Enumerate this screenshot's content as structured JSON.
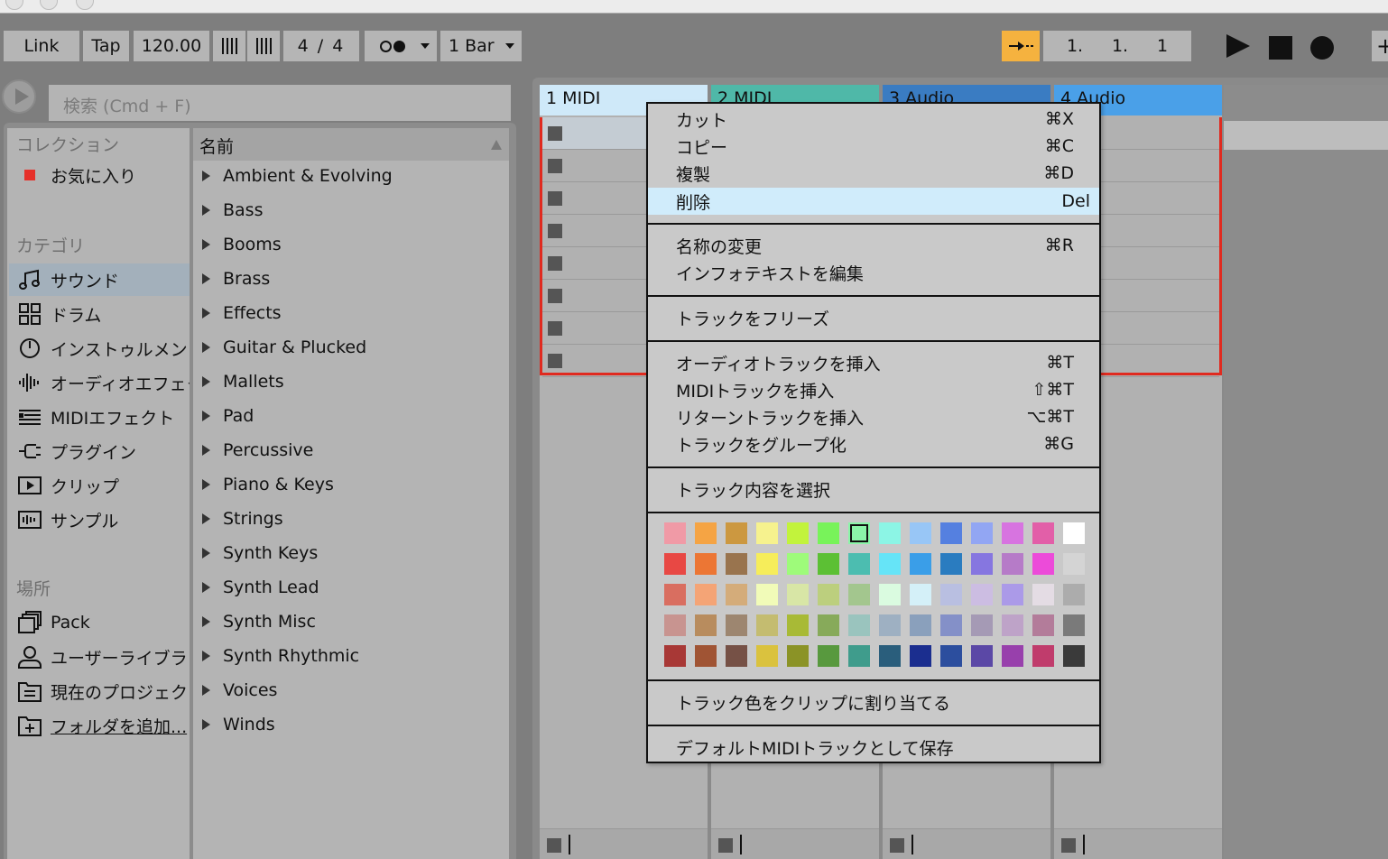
{
  "transport": {
    "link": "Link",
    "tap": "Tap",
    "tempo": "120.00",
    "signature": "4 / 4",
    "quantize": "1 Bar",
    "arrangement_pos": [
      "1.",
      "1.",
      "1"
    ]
  },
  "browser": {
    "search_placeholder": "検索 (Cmd + F)",
    "collections_header": "コレクション",
    "favorites": "お気に入り",
    "categories_header": "カテゴリ",
    "categories": [
      {
        "label": "サウンド",
        "icon": "music-note-icon"
      },
      {
        "label": "ドラム",
        "icon": "drum-grid-icon"
      },
      {
        "label": "インストゥルメント",
        "icon": "clock-icon"
      },
      {
        "label": "オーディオエフェクト",
        "icon": "waveform-icon"
      },
      {
        "label": "MIDIエフェクト",
        "icon": "midi-lines-icon"
      },
      {
        "label": "プラグイン",
        "icon": "plug-icon"
      },
      {
        "label": "クリップ",
        "icon": "clip-icon"
      },
      {
        "label": "サンプル",
        "icon": "sample-icon"
      }
    ],
    "places_header": "場所",
    "places": [
      {
        "label": "Pack",
        "icon": "pack-icon"
      },
      {
        "label": "ユーザーライブラリ",
        "icon": "user-icon"
      },
      {
        "label": "現在のプロジェクト",
        "icon": "project-folder-icon"
      },
      {
        "label": "フォルダを追加...",
        "icon": "add-folder-icon"
      }
    ],
    "list_header": "名前",
    "items": [
      "Ambient & Evolving",
      "Bass",
      "Booms",
      "Brass",
      "Effects",
      "Guitar & Plucked",
      "Mallets",
      "Pad",
      "Percussive",
      "Piano & Keys",
      "Strings",
      "Synth Keys",
      "Synth Lead",
      "Synth Misc",
      "Synth Rhythmic",
      "Voices",
      "Winds"
    ]
  },
  "tracks": [
    {
      "name": "1 MIDI",
      "color": "#cfe9f9"
    },
    {
      "name": "2 MIDI",
      "color": "#4fb8a8"
    },
    {
      "name": "3 Audio",
      "color": "#3a7cc2"
    },
    {
      "name": "4 Audio",
      "color": "#4aa0e8"
    }
  ],
  "menu": {
    "items": [
      {
        "label": "カット",
        "shortcut": "⌘X"
      },
      {
        "label": "コピー",
        "shortcut": "⌘C"
      },
      {
        "label": "複製",
        "shortcut": "⌘D"
      },
      {
        "label": "削除",
        "shortcut": "Del"
      },
      {
        "label": "名称の変更",
        "shortcut": "⌘R"
      },
      {
        "label": "インフォテキストを編集",
        "shortcut": ""
      },
      {
        "label": "トラックをフリーズ",
        "shortcut": ""
      },
      {
        "label": "オーディオトラックを挿入",
        "shortcut": "⌘T"
      },
      {
        "label": "MIDIトラックを挿入",
        "shortcut": "⇧⌘T"
      },
      {
        "label": "リターントラックを挿入",
        "shortcut": "⌥⌘T"
      },
      {
        "label": "トラックをグループ化",
        "shortcut": "⌘G"
      },
      {
        "label": "トラック内容を選択",
        "shortcut": ""
      },
      {
        "label": "トラック色をクリップに割り当てる",
        "shortcut": ""
      },
      {
        "label": "デフォルトMIDIトラックとして保存",
        "shortcut": ""
      }
    ],
    "highlighted_index": 3,
    "selected_color_index": 6,
    "palette": [
      "#f09aa6",
      "#f5a444",
      "#cc9840",
      "#f6f28e",
      "#c2f33c",
      "#78f35a",
      "#8bf5a8",
      "#8cf5e5",
      "#98c6f6",
      "#5580e0",
      "#92a6f3",
      "#d774e0",
      "#e25fa8",
      "#ffffff",
      "#e84844",
      "#ec7634",
      "#99744e",
      "#f6ed5a",
      "#9efb7a",
      "#5cc034",
      "#4cbdb0",
      "#66e4f7",
      "#3a9ee8",
      "#2a7cc0",
      "#8676e0",
      "#b67bc8",
      "#ec4bd9",
      "#d4d4d4",
      "#d96e60",
      "#f4a476",
      "#d4ac7a",
      "#f1fbb8",
      "#d8e6a6",
      "#bccf7e",
      "#a3c68e",
      "#dafbe0",
      "#d4f0f8",
      "#b9bfe1",
      "#ccbde2",
      "#ab9ae8",
      "#e4dce4",
      "#acacac",
      "#c89490",
      "#b88c5e",
      "#9d8670",
      "#c4bc70",
      "#a8ba36",
      "#87aa5a",
      "#9ac4be",
      "#9eb0c2",
      "#8aa0bc",
      "#8490c8",
      "#a59ab5",
      "#bea3c8",
      "#b37c9a",
      "#7a7a7a",
      "#a83836",
      "#a05434",
      "#765146",
      "#dac23e",
      "#8b9326",
      "#58993e",
      "#3f9c8c",
      "#2a5e7c",
      "#1b2e8f",
      "#2c4e9e",
      "#5b48a6",
      "#9840ac",
      "#c03c6c",
      "#3a3a3a"
    ]
  }
}
